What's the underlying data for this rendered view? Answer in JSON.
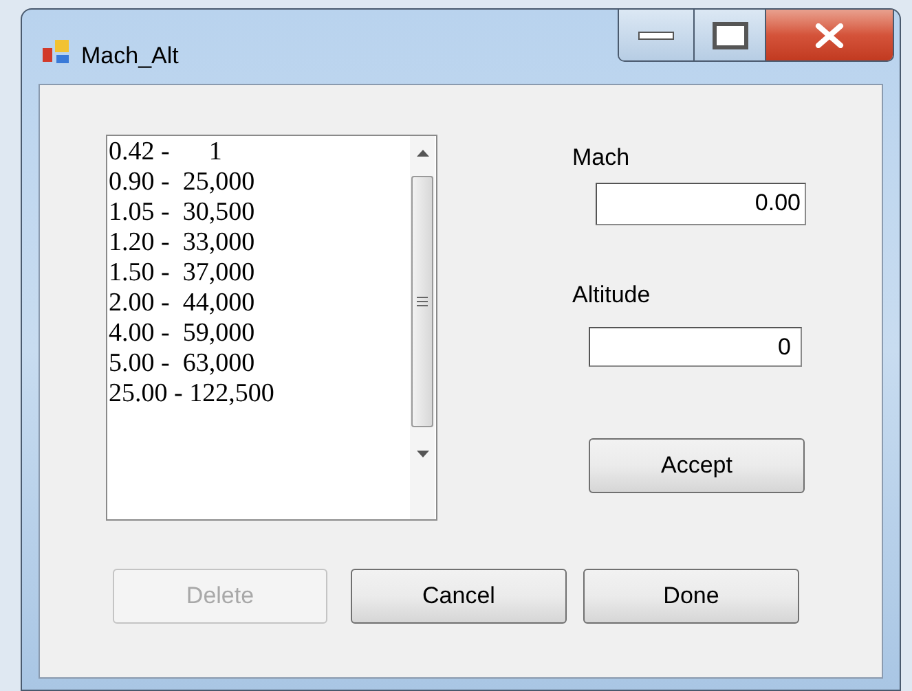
{
  "window": {
    "title": "Mach_Alt"
  },
  "list": {
    "items": [
      {
        "text": "0.42 -      1"
      },
      {
        "text": "0.90 -  25,000"
      },
      {
        "text": "1.05 -  30,500"
      },
      {
        "text": "1.20 -  33,000"
      },
      {
        "text": "1.50 -  37,000"
      },
      {
        "text": "2.00 -  44,000"
      },
      {
        "text": "4.00 -  59,000"
      },
      {
        "text": "5.00 -  63,000"
      },
      {
        "text": "25.00 - 122,500"
      }
    ]
  },
  "mach": {
    "label": "Mach",
    "value": "0.00"
  },
  "altitude": {
    "label": "Altitude",
    "value": "0"
  },
  "accept_button": {
    "label": "Accept",
    "disabled": false
  },
  "buttons": [
    {
      "label": "Delete",
      "disabled": true
    },
    {
      "label": "Cancel",
      "disabled": false
    },
    {
      "label": "Done",
      "disabled": false
    }
  ]
}
